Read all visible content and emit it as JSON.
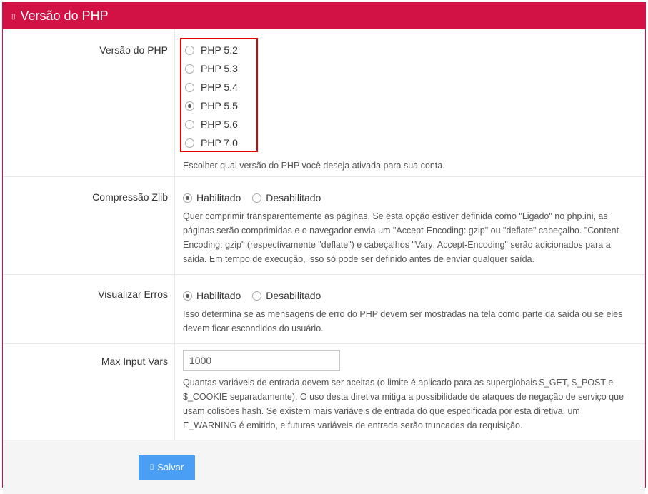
{
  "panel": {
    "title": "Versão do PHP",
    "title_icon": "▯"
  },
  "php_version": {
    "label": "Versão do PHP",
    "options": [
      "PHP 5.2",
      "PHP 5.3",
      "PHP 5.4",
      "PHP 5.5",
      "PHP 5.6",
      "PHP 7.0"
    ],
    "selected": "PHP 5.5",
    "help": "Escolher qual versão do PHP você deseja ativada para sua conta."
  },
  "zlib": {
    "label": "Compressão Zlib",
    "enabled_label": "Habilitado",
    "disabled_label": "Desabilitado",
    "selected": "Habilitado",
    "help": "Quer comprimir transparentemente as páginas. Se esta opção estiver definida como \"Ligado\" no php.ini, as páginas serão comprimidas e o navegador envia um \"Accept-Encoding: gzip\" ou \"deflate\" cabeçalho. \"Content-Encoding: gzip\" (respectivamente \"deflate\") e cabeçalhos \"Vary: Accept-Encoding\" serão adicionados para a saida. Em tempo de execução, isso só pode ser definido antes de enviar qualquer saída."
  },
  "errors": {
    "label": "Visualizar Erros",
    "enabled_label": "Habilitado",
    "disabled_label": "Desabilitado",
    "selected": "Habilitado",
    "help": "Isso determina se as mensagens de erro do PHP devem ser mostradas na tela como parte da saída ou se eles devem ficar escondidos do usuário."
  },
  "max_input_vars": {
    "label": "Max Input Vars",
    "value": "1000",
    "help": "Quantas variáveis de entrada devem ser aceitas (o limite é aplicado para as superglobais $_GET, $_POST e $_COOKIE separadamente). O uso desta diretiva mitiga a possibilidade de ataques de negação de serviço que usam colisões hash. Se existem mais variáveis de entrada do que especificada por esta diretiva, um E_WARNING é emitido, e futuras variáveis de entrada serão truncadas da requisição."
  },
  "footer": {
    "save_label": "Salvar",
    "save_icon": "▯"
  },
  "colors": {
    "header": "#d21245",
    "highlight_border": "#e60000",
    "button": "#4a9ff5"
  }
}
